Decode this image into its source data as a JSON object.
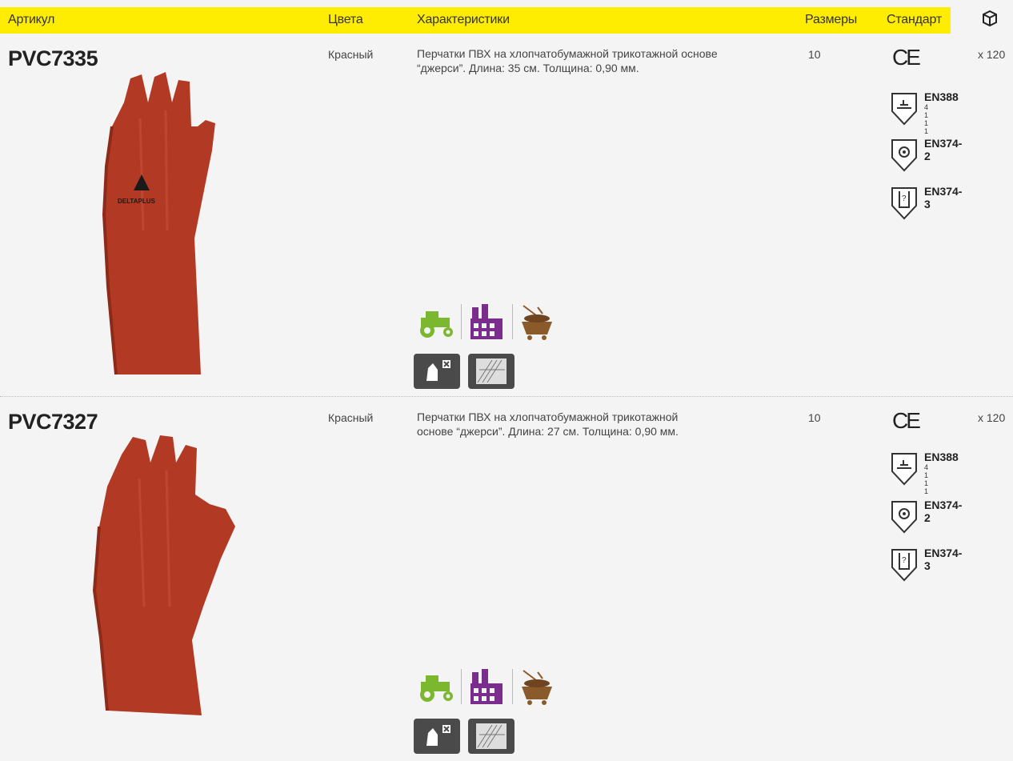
{
  "header": {
    "col_article": "Артикул",
    "col_colors": "Цвета",
    "col_features": "Характеристики",
    "col_sizes": "Размеры",
    "col_standard": "Стандарт",
    "box_icon": "box-icon",
    "bar_color": "#ffed00"
  },
  "products": [
    {
      "sku": "PVC7335",
      "color": "Красный",
      "description": "Перчатки ПВХ на хлопчатобумажной трикотажной основе “джерси”. Длина: 35 см. Толщина: 0,90 мм.",
      "size": "10",
      "pack": "x 120",
      "ce": "CE",
      "glove_print": "DELTAPLUS",
      "standards": [
        {
          "label": "EN388",
          "sub": "4 1 1 1",
          "icon": "mechanical-hazard-icon"
        },
        {
          "label": "EN374-2",
          "sub": "",
          "icon": "biohazard-icon"
        },
        {
          "label": "EN374-3",
          "sub": "",
          "icon": "chemical-hazard-icon"
        }
      ],
      "sectors": [
        "agriculture-tractor-icon",
        "industry-factory-icon",
        "mining-cart-icon"
      ],
      "pictograms": [
        "hand-protection-icon",
        "surface-texture-icon"
      ]
    },
    {
      "sku": "PVC7327",
      "color": "Красный",
      "description": "Перчатки ПВХ на хлопчатобумажной трикотажной основе “джерси”. Длина: 27 см. Толщина: 0,90 мм.",
      "size": "10",
      "pack": "x 120",
      "ce": "CE",
      "standards": [
        {
          "label": "EN388",
          "sub": "4 1 1 1",
          "icon": "mechanical-hazard-icon"
        },
        {
          "label": "EN374-2",
          "sub": "",
          "icon": "biohazard-icon"
        },
        {
          "label": "EN374-3",
          "sub": "",
          "icon": "chemical-hazard-icon"
        }
      ],
      "sectors": [
        "agriculture-tractor-icon",
        "industry-factory-icon",
        "mining-cart-icon"
      ],
      "pictograms": [
        "hand-protection-icon",
        "surface-texture-icon"
      ]
    }
  ],
  "colors": {
    "glove": "#b23a24",
    "tractor": "#7cb82f",
    "factory": "#7b2d8e",
    "cart": "#8a5a2b"
  }
}
